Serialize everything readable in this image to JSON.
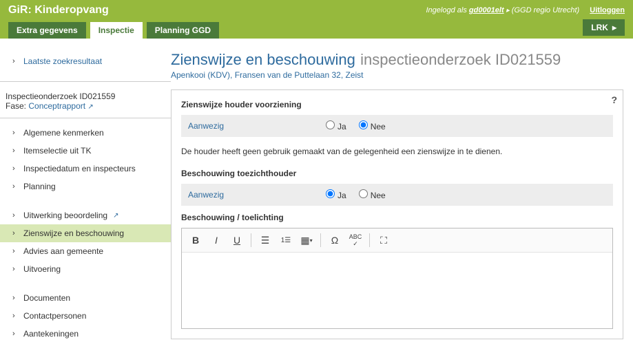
{
  "header": {
    "brand": "GiR: Kinderopvang",
    "logged_in_prefix": "Ingelogd als",
    "username": "gd0001elt",
    "org": "(GGD regio Utrecht)",
    "logout": "Uitloggen",
    "lrk": "LRK"
  },
  "tabs": [
    {
      "label": "Extra gegevens",
      "active": false
    },
    {
      "label": "Inspectie",
      "active": true
    },
    {
      "label": "Planning GGD",
      "active": false
    }
  ],
  "sidebar": {
    "last_search": "Laatste zoekresultaat",
    "phase": {
      "line1": "Inspectieonderzoek ID021559",
      "fase_label": "Fase:",
      "fase_value": "Conceptrapport"
    },
    "group1": [
      "Algemene kenmerken",
      "Itemselectie uit TK",
      "Inspectiedatum en inspecteurs",
      "Planning"
    ],
    "group2": [
      {
        "label": "Uitwerking beoordeling",
        "ext": true,
        "active": false
      },
      {
        "label": "Zienswijze en beschouwing",
        "ext": false,
        "active": true
      },
      {
        "label": "Advies aan gemeente",
        "ext": false,
        "active": false
      },
      {
        "label": "Uitvoering",
        "ext": false,
        "active": false
      }
    ],
    "group3": [
      "Documenten",
      "Contactpersonen",
      "Aantekeningen"
    ]
  },
  "main": {
    "title": "Zienswijze en beschouwing",
    "title_sub": "inspectieonderzoek ID021559",
    "subtitle": "Apenkooi (KDV), Fransen van de Puttelaan 32, Zeist",
    "section1": {
      "title": "Zienswijze houder voorziening",
      "field_label": "Aanwezig",
      "ja": "Ja",
      "nee": "Nee",
      "selected": "Nee",
      "note": "De houder heeft geen gebruik gemaakt van de gelegenheid een zienswijze in te dienen."
    },
    "section2": {
      "title": "Beschouwing toezichthouder",
      "field_label": "Aanwezig",
      "ja": "Ja",
      "nee": "Nee",
      "selected": "Ja",
      "subtitle": "Beschouwing / toelichting"
    }
  }
}
